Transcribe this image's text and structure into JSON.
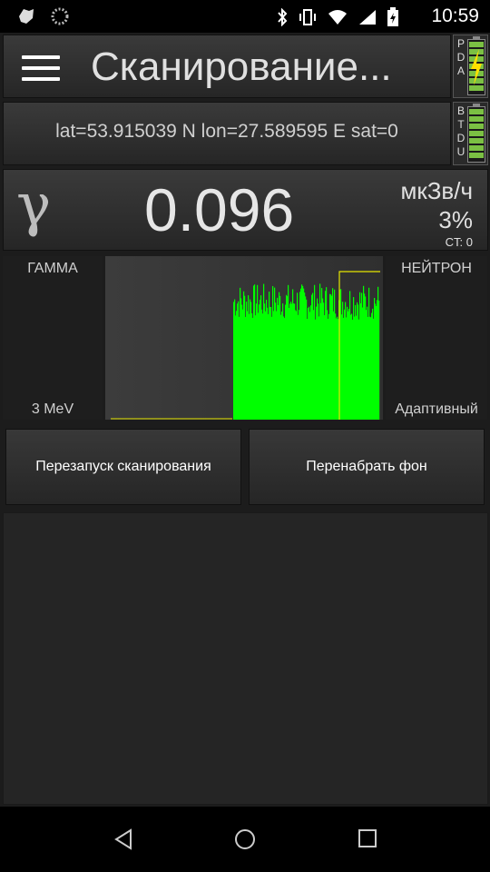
{
  "status_bar": {
    "time": "10:59",
    "left_icons": [
      "app-notification-icon",
      "sync-icon"
    ],
    "right_icons": [
      "bluetooth-icon",
      "vibrate-icon",
      "wifi-icon",
      "signal-icon",
      "battery-charging-icon"
    ]
  },
  "header": {
    "title": "Сканирование...",
    "pda_battery": {
      "letters": [
        "P",
        "D",
        "A"
      ],
      "charging": true,
      "level": 1.0
    },
    "btdu_battery": {
      "letters": [
        "B",
        "T",
        "D",
        "U"
      ],
      "charging": false,
      "level": 1.0
    }
  },
  "gps": {
    "text": "lat=53.915039 N lon=27.589595 E sat=0"
  },
  "dose": {
    "symbol": "γ",
    "value": "0.096",
    "unit": "мкЗв/ч",
    "percent": "3%",
    "count": "CT: 0"
  },
  "spectrum": {
    "left_top_label": "ГАММА",
    "left_bottom_label": "3 MeV",
    "right_top_label": "НЕЙТРОН",
    "right_bottom_label": "Адаптивный",
    "bar_color": "#00ff00",
    "line_color": "#e6e600"
  },
  "buttons": {
    "restart_label": "Перезапуск сканирования",
    "rebackground_label": "Перенабрать фон"
  },
  "colors": {
    "accent_green": "#00ff00",
    "battery_green": "#7bc043"
  }
}
